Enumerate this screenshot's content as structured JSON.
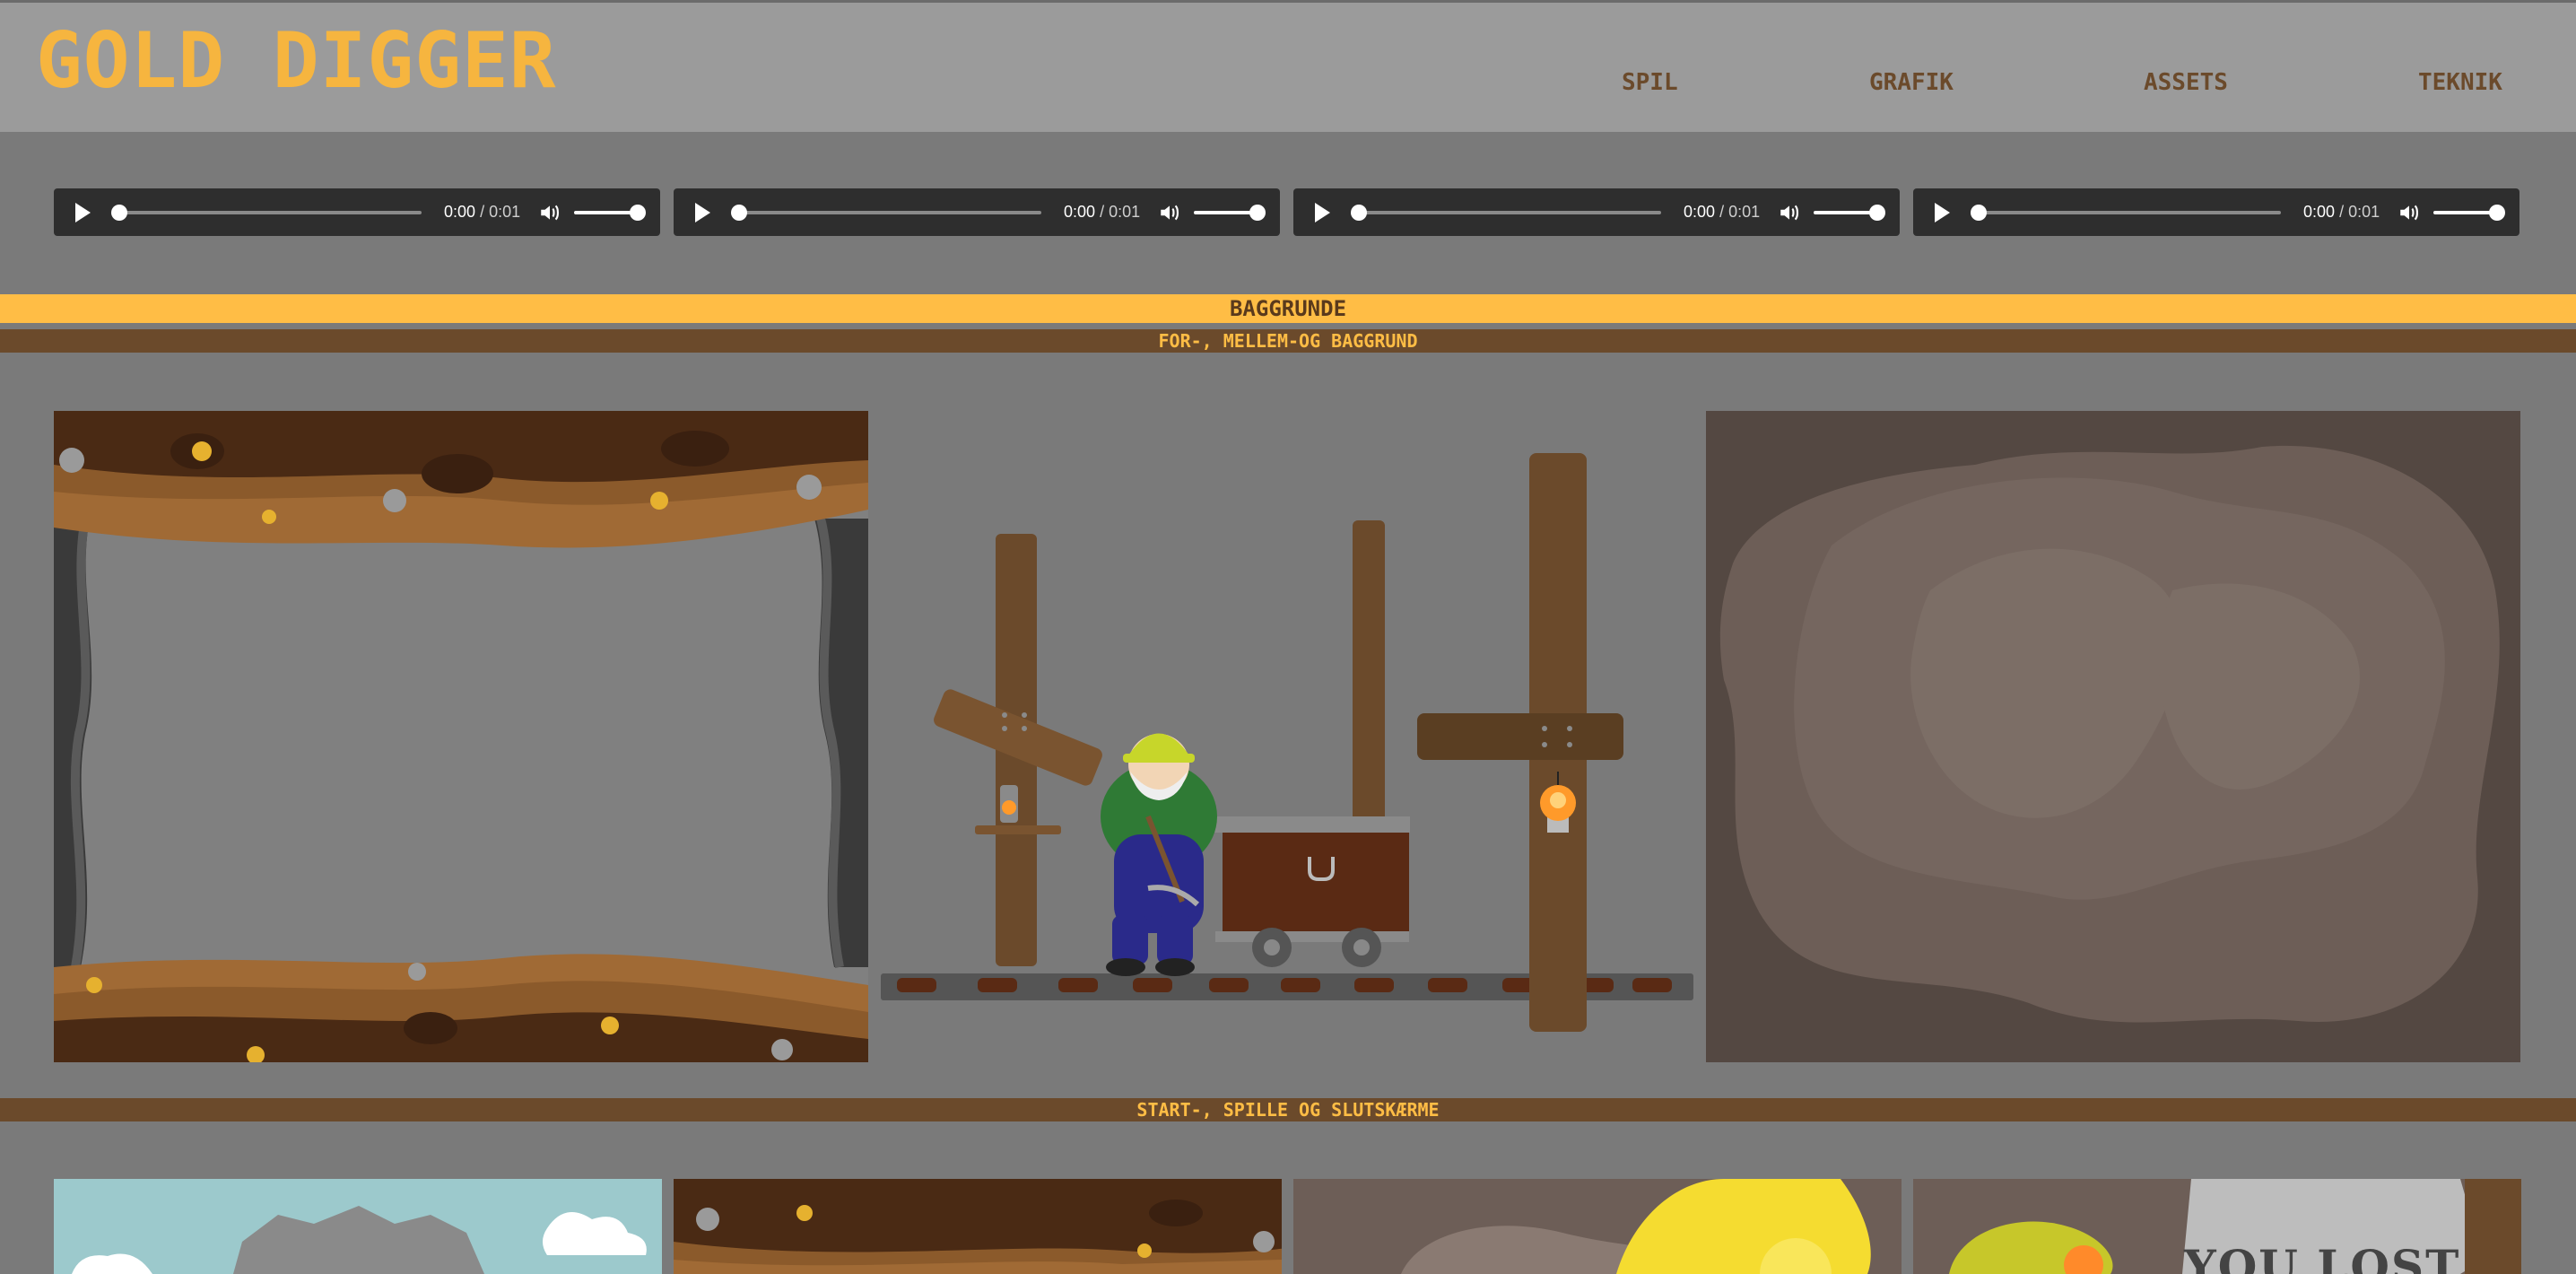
{
  "header": {
    "title": "GOLD DIGGER",
    "nav": [
      "SPIL",
      "GRAFIK",
      "ASSETS",
      "TEKNIK"
    ]
  },
  "audio_players": [
    {
      "current": "0:00",
      "duration": "/ 0:01"
    },
    {
      "current": "0:00",
      "duration": "/ 0:01"
    },
    {
      "current": "0:00",
      "duration": "/ 0:01"
    },
    {
      "current": "0:00",
      "duration": "/ 0:01"
    }
  ],
  "sections": {
    "backgrounds_title": "BAGGRUNDE",
    "layers_subtitle": "FOR-, MELLEM-OG BAGGRUND",
    "screens_subtitle": "START-, SPILLE OG SLUTSKÆRME"
  },
  "screen_previews": {
    "lost_text": "YOU LOST"
  },
  "colors": {
    "accent": "#ffbd45",
    "brown": "#6b4a2b",
    "background": "#7a7a7a",
    "header": "#9b9b9b"
  }
}
